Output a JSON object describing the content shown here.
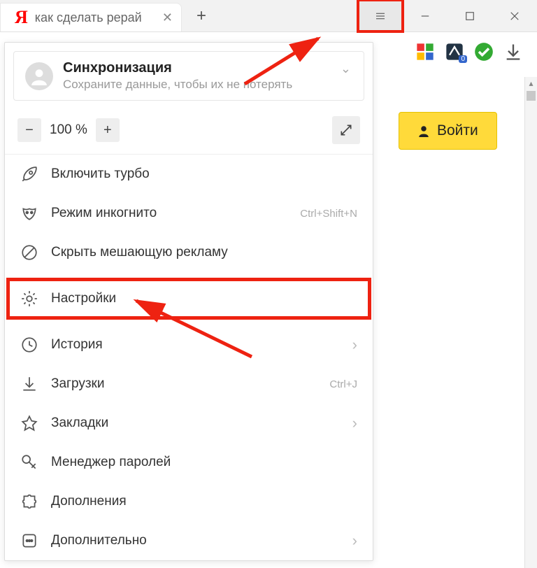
{
  "titlebar": {
    "tab_title": "как сделать рерай",
    "logo_letter": "Я"
  },
  "sync": {
    "title": "Синхронизация",
    "subtitle": "Сохраните данные, чтобы их не потерять"
  },
  "zoom": {
    "value": "100 %"
  },
  "menu_items": [
    {
      "id": "turbo",
      "label": "Включить турбо",
      "shortcut": "",
      "arrow": false
    },
    {
      "id": "incognito",
      "label": "Режим инкогнито",
      "shortcut": "Ctrl+Shift+N",
      "arrow": false
    },
    {
      "id": "hideads",
      "label": "Скрыть мешающую рекламу",
      "shortcut": "",
      "arrow": false
    },
    {
      "id": "settings",
      "label": "Настройки",
      "shortcut": "",
      "arrow": false,
      "highlight": true
    },
    {
      "id": "history",
      "label": "История",
      "shortcut": "",
      "arrow": true
    },
    {
      "id": "downloads",
      "label": "Загрузки",
      "shortcut": "Ctrl+J",
      "arrow": false
    },
    {
      "id": "bookmarks",
      "label": "Закладки",
      "shortcut": "",
      "arrow": true
    },
    {
      "id": "passwords",
      "label": "Менеджер паролей",
      "shortcut": "",
      "arrow": false
    },
    {
      "id": "addons",
      "label": "Дополнения",
      "shortcut": "",
      "arrow": false
    },
    {
      "id": "more",
      "label": "Дополнительно",
      "shortcut": "",
      "arrow": true
    }
  ],
  "page": {
    "login_label": "Войти"
  },
  "toolbar_icons": {
    "badge_count": "0"
  },
  "colors": {
    "highlight": "#e21",
    "accent_yellow": "#ffda3a"
  }
}
